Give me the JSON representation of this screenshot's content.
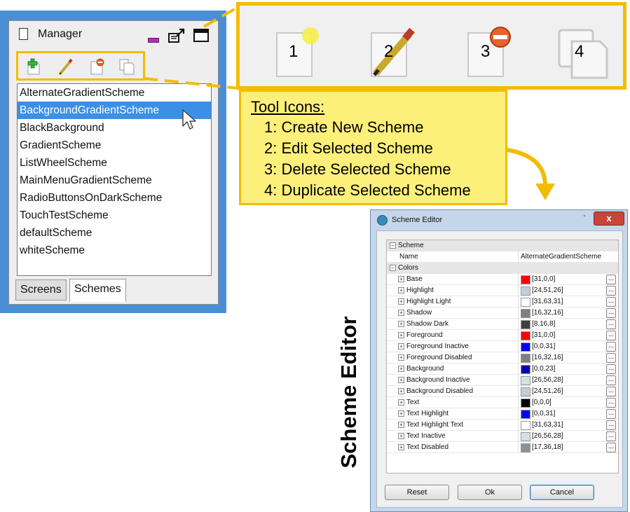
{
  "manager": {
    "title": "Manager",
    "schemes": [
      "AlternateGradientScheme",
      "BackgroundGradientScheme",
      "BlackBackground",
      "GradientScheme",
      "ListWheelScheme",
      "MainMenuGradientScheme",
      "RadioButtonsOnDarkScheme",
      "TouchTestScheme",
      "defaultScheme",
      "whiteScheme"
    ],
    "selected_scheme": "BackgroundGradientScheme",
    "tabs": [
      "Screens",
      "Schemes"
    ],
    "active_tab": "Schemes"
  },
  "zoom": {
    "numbers": [
      "1",
      "2",
      "3",
      "4"
    ]
  },
  "note": {
    "title": "Tool Icons:",
    "lines": [
      "1: Create New Scheme",
      "2: Edit Selected Scheme",
      "3: Delete Selected Scheme",
      "4: Duplicate Selected Scheme"
    ]
  },
  "editor_label": "Scheme Editor",
  "editor": {
    "title": "Scheme Editor",
    "close_glyph": "x",
    "min_glyph": "-",
    "scheme_group": "Scheme",
    "name_label": "Name",
    "name_value": "AlternateGradientScheme",
    "colors_group": "Colors",
    "dots": "...",
    "colors": [
      {
        "name": "Base",
        "value": "[31,0,0]",
        "color": "#ff0000"
      },
      {
        "name": "Highlight",
        "value": "[24,51,26]",
        "color": "#c5cdd6"
      },
      {
        "name": "Highlight Light",
        "value": "[31,63,31]",
        "color": "#ffffff"
      },
      {
        "name": "Shadow",
        "value": "[16,32,16]",
        "color": "#808080"
      },
      {
        "name": "Shadow  Dark",
        "value": "[8,16,8]",
        "color": "#404040"
      },
      {
        "name": "Foreground",
        "value": "[31,0,0]",
        "color": "#ff0000"
      },
      {
        "name": "Foreground Inactive",
        "value": "[0,0,31]",
        "color": "#0000ff"
      },
      {
        "name": "Foreground Disabled",
        "value": "[16,32,16]",
        "color": "#808080"
      },
      {
        "name": "Background",
        "value": "[0,0,23]",
        "color": "#0000b8"
      },
      {
        "name": "Background Inactive",
        "value": "[26,56,28]",
        "color": "#d3e2e6"
      },
      {
        "name": "Background Disabled",
        "value": "[24,51,26]",
        "color": "#c5cdd6"
      },
      {
        "name": "Text",
        "value": "[0,0,0]",
        "color": "#000000"
      },
      {
        "name": "Text Highlight",
        "value": "[0,0,31]",
        "color": "#0000ff"
      },
      {
        "name": "Text Highlight Text",
        "value": "[31,63,31]",
        "color": "#ffffff"
      },
      {
        "name": "Text Inactive",
        "value": "[26,56,28]",
        "color": "#d3e2e6"
      },
      {
        "name": "Text Disabled",
        "value": "[17,36,18]",
        "color": "#8c9194"
      }
    ],
    "buttons": {
      "reset": "Reset",
      "ok": "Ok",
      "cancel": "Cancel"
    }
  },
  "accent_colors": {
    "callout": "#f3bc00",
    "note_bg": "#fdf07a",
    "selection": "#3c8fe6",
    "manager_frame": "#4a8fd6"
  }
}
